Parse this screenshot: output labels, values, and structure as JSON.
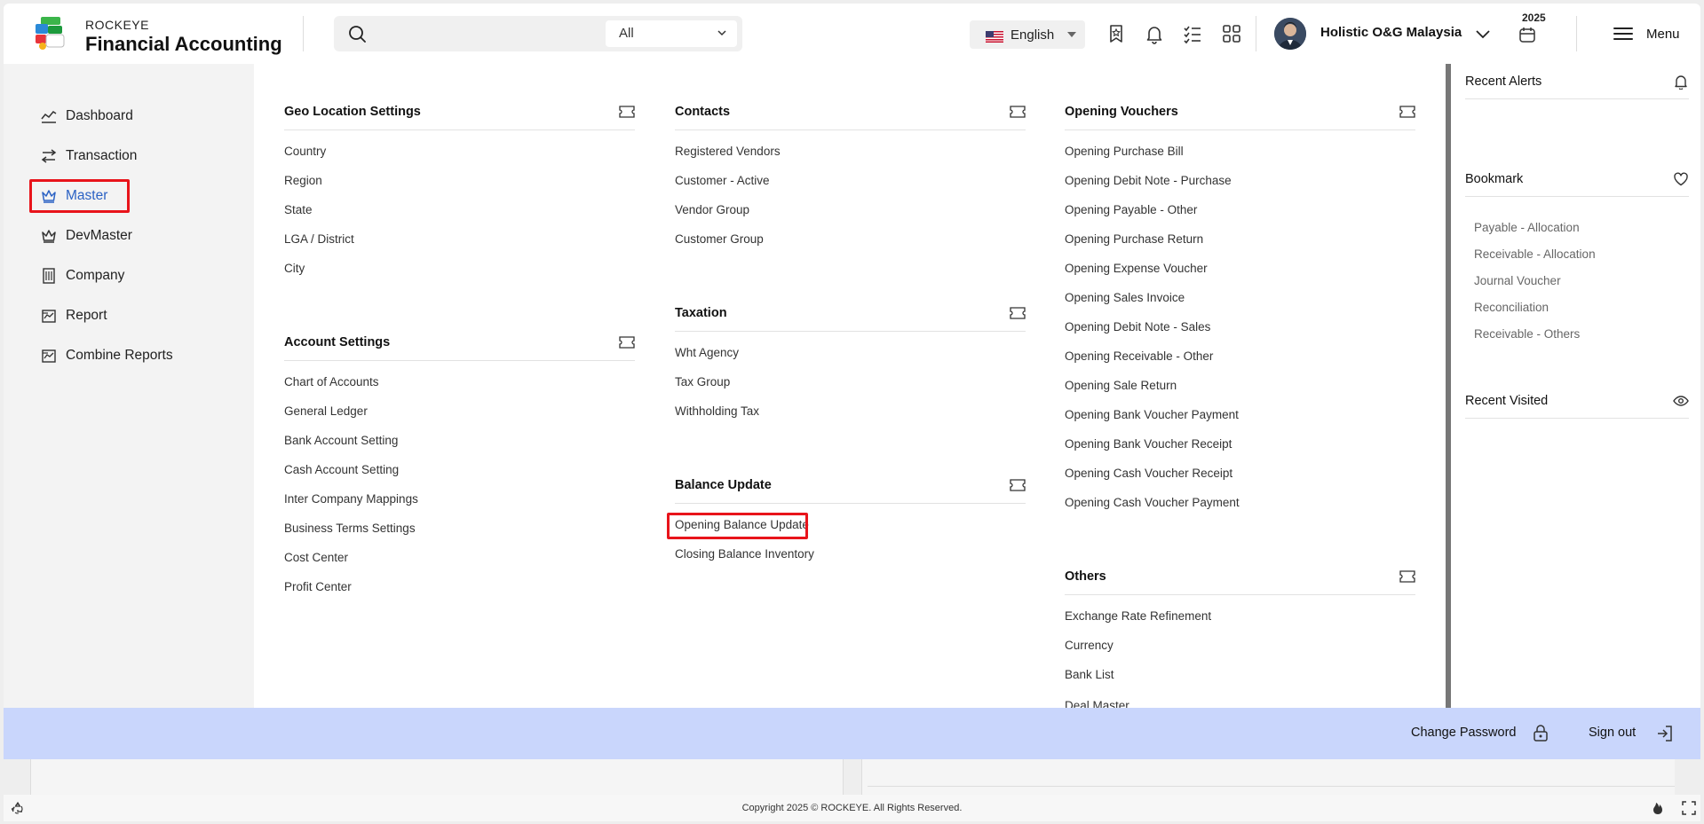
{
  "header": {
    "brand_top": "ROCKEYE",
    "brand_main": "Financial Accounting",
    "search_scope": "All",
    "language": "English",
    "company": "Holistic O&G Malaysia",
    "year": "2025",
    "menu_label": "Menu"
  },
  "leftnav": {
    "items": [
      {
        "label": "Dashboard",
        "icon": "chart-line-icon"
      },
      {
        "label": "Transaction",
        "icon": "swap-arrows-icon"
      },
      {
        "label": "Master",
        "icon": "crown-icon",
        "active": true
      },
      {
        "label": "DevMaster",
        "icon": "crown-icon"
      },
      {
        "label": "Company",
        "icon": "building-icon"
      },
      {
        "label": "Report",
        "icon": "report-icon"
      },
      {
        "label": "Combine Reports",
        "icon": "report-icon"
      }
    ]
  },
  "mega": {
    "geo": {
      "title": "Geo Location Settings",
      "links": [
        "Country",
        "Region",
        "State",
        "LGA / District",
        "City"
      ]
    },
    "account": {
      "title": "Account Settings",
      "links": [
        "Chart of Accounts",
        "General Ledger",
        "Bank Account Setting",
        "Cash Account Setting",
        "Inter Company Mappings",
        "Business Terms Settings",
        "Cost Center",
        "Profit Center"
      ]
    },
    "contacts": {
      "title": "Contacts",
      "links": [
        "Registered Vendors",
        "Customer - Active",
        "Vendor Group",
        "Customer Group"
      ]
    },
    "taxation": {
      "title": "Taxation",
      "links": [
        "Wht Agency",
        "Tax Group",
        "Withholding Tax"
      ]
    },
    "balance": {
      "title": "Balance Update",
      "links": [
        "Opening Balance Update",
        "Closing Balance Inventory"
      ]
    },
    "vouchers": {
      "title": "Opening Vouchers",
      "links": [
        "Opening Purchase Bill",
        "Opening Debit Note - Purchase",
        "Opening Payable - Other",
        "Opening Purchase Return",
        "Opening Expense Voucher",
        "Opening Sales Invoice",
        "Opening Debit Note - Sales",
        "Opening Receivable - Other",
        "Opening Sale Return",
        "Opening Bank Voucher Payment",
        "Opening Bank Voucher Receipt",
        "Opening Cash Voucher Receipt",
        "Opening Cash Voucher Payment"
      ]
    },
    "others": {
      "title": "Others",
      "links": [
        "Exchange Rate Refinement",
        "Currency",
        "Bank List",
        "Deal Master"
      ]
    }
  },
  "rightpanel": {
    "recent_alerts": "Recent Alerts",
    "bookmark": "Bookmark",
    "bookmarks": [
      "Payable - Allocation",
      "Receivable - Allocation",
      "Journal Voucher",
      "Reconciliation",
      "Receivable - Others"
    ],
    "recent_visited": "Recent Visited"
  },
  "bottombar": {
    "change_password": "Change Password",
    "sign_out": "Sign out"
  },
  "footer": {
    "copyright": "Copyright 2025 © ROCKEYE. All Rights Reserved."
  },
  "colors": {
    "accent": "#2b62c4",
    "highlight": "#e8141b",
    "bottombar": "#c9d6fc"
  }
}
